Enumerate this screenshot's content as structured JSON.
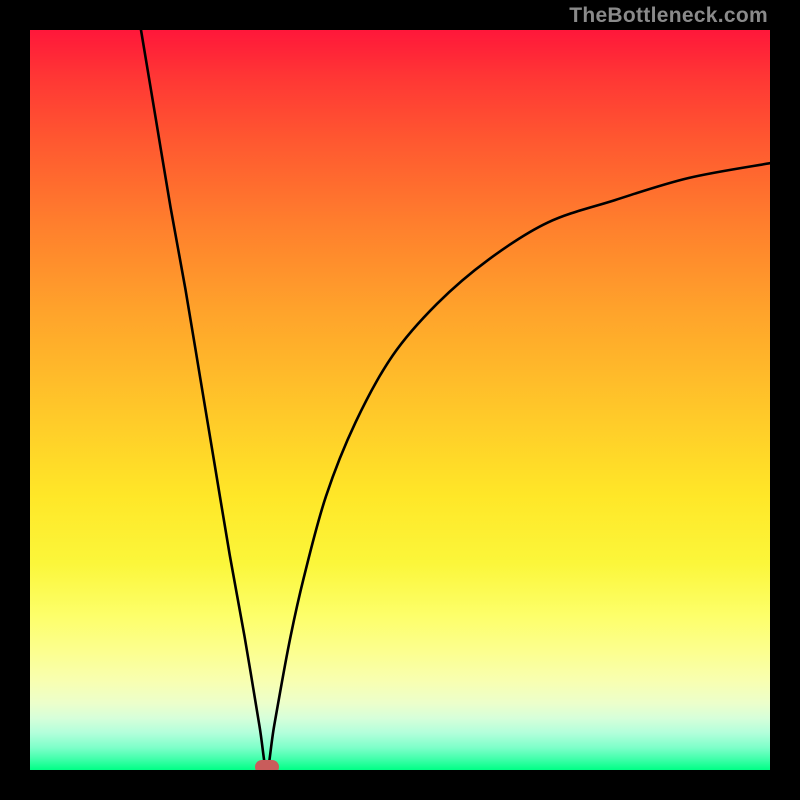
{
  "attribution": "TheBottleneck.com",
  "colors": {
    "frame": "#000000",
    "curve": "#000000",
    "marker": "#c95c5b",
    "gradient_top": "#ff173a",
    "gradient_bottom": "#00ff86"
  },
  "chart_data": {
    "type": "line",
    "title": "",
    "xlabel": "",
    "ylabel": "",
    "xlim": [
      0,
      100
    ],
    "ylim": [
      0,
      100
    ],
    "grid": false,
    "curve_min_x": 32,
    "curve_min_y": 0,
    "marker": {
      "x": 32,
      "y": 0
    },
    "points": [
      {
        "x": 15,
        "y": 100
      },
      {
        "x": 17,
        "y": 88
      },
      {
        "x": 19,
        "y": 76
      },
      {
        "x": 21,
        "y": 65
      },
      {
        "x": 23,
        "y": 53
      },
      {
        "x": 25,
        "y": 41
      },
      {
        "x": 27,
        "y": 29
      },
      {
        "x": 29,
        "y": 18
      },
      {
        "x": 31,
        "y": 6
      },
      {
        "x": 32,
        "y": 0
      },
      {
        "x": 33,
        "y": 6
      },
      {
        "x": 35,
        "y": 17
      },
      {
        "x": 37,
        "y": 26
      },
      {
        "x": 40,
        "y": 37
      },
      {
        "x": 44,
        "y": 47
      },
      {
        "x": 49,
        "y": 56
      },
      {
        "x": 55,
        "y": 63
      },
      {
        "x": 62,
        "y": 69
      },
      {
        "x": 70,
        "y": 74
      },
      {
        "x": 79,
        "y": 77
      },
      {
        "x": 89,
        "y": 80
      },
      {
        "x": 100,
        "y": 82
      }
    ]
  }
}
